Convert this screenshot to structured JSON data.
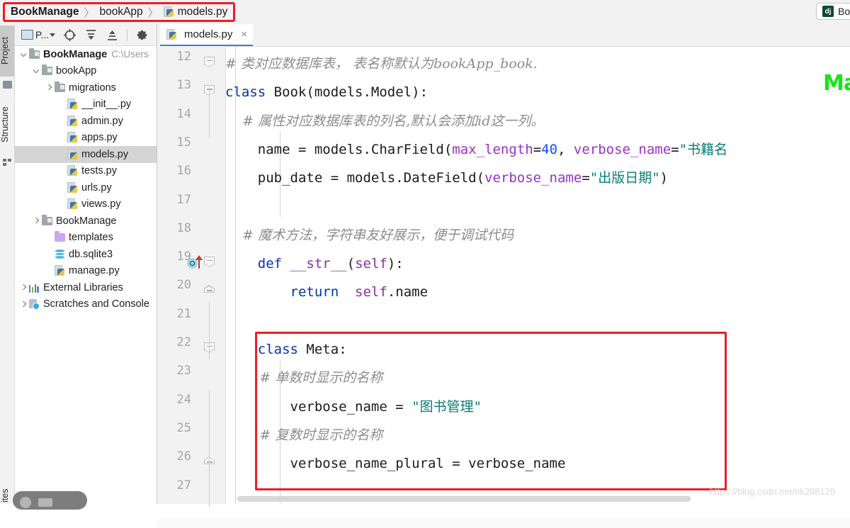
{
  "breadcrumb": {
    "items": [
      {
        "label": "BookManage",
        "bold": true,
        "icon": "none"
      },
      {
        "label": "bookApp",
        "bold": false,
        "icon": "none"
      },
      {
        "label": "models.py",
        "bold": false,
        "icon": "python-file-icon"
      }
    ],
    "separator": "〉"
  },
  "run_config": {
    "badge": "dj",
    "label": "Bo"
  },
  "tool_windows": {
    "project_tab": "Project",
    "structure_tab": "Structure",
    "favorites_tab": "ites"
  },
  "project_panel": {
    "toolbar": {
      "scope_label": "P...",
      "buttons": [
        {
          "name": "project-scope-selector",
          "label": "P..."
        },
        {
          "name": "locate-in-tree-button",
          "label": ""
        },
        {
          "name": "expand-all-button",
          "label": ""
        },
        {
          "name": "collapse-all-button",
          "label": ""
        },
        {
          "name": "settings-gear-button",
          "label": ""
        }
      ]
    },
    "tree": [
      {
        "label": "BookManage",
        "path": "C:\\Users",
        "icon": "folder-module-icon",
        "arrow": "down",
        "indent": 0,
        "bold": true,
        "selected": false
      },
      {
        "label": "bookApp",
        "path": "",
        "icon": "folder-module-icon",
        "arrow": "down",
        "indent": 1,
        "bold": false,
        "selected": false
      },
      {
        "label": "migrations",
        "path": "",
        "icon": "folder-module-icon",
        "arrow": "right",
        "indent": 2,
        "bold": false,
        "selected": false
      },
      {
        "label": "__init__.py",
        "path": "",
        "icon": "python-file-icon",
        "arrow": "none",
        "indent": 3,
        "bold": false,
        "selected": false
      },
      {
        "label": "admin.py",
        "path": "",
        "icon": "python-file-icon",
        "arrow": "none",
        "indent": 3,
        "bold": false,
        "selected": false
      },
      {
        "label": "apps.py",
        "path": "",
        "icon": "python-file-icon",
        "arrow": "none",
        "indent": 3,
        "bold": false,
        "selected": false
      },
      {
        "label": "models.py",
        "path": "",
        "icon": "python-file-icon",
        "arrow": "none",
        "indent": 3,
        "bold": false,
        "selected": true
      },
      {
        "label": "tests.py",
        "path": "",
        "icon": "python-file-icon",
        "arrow": "none",
        "indent": 3,
        "bold": false,
        "selected": false
      },
      {
        "label": "urls.py",
        "path": "",
        "icon": "python-file-icon",
        "arrow": "none",
        "indent": 3,
        "bold": false,
        "selected": false
      },
      {
        "label": "views.py",
        "path": "",
        "icon": "python-file-icon",
        "arrow": "none",
        "indent": 3,
        "bold": false,
        "selected": false
      },
      {
        "label": "BookManage",
        "path": "",
        "icon": "folder-module-icon",
        "arrow": "right",
        "indent": 1,
        "bold": false,
        "selected": false
      },
      {
        "label": "templates",
        "path": "",
        "icon": "folder-purple-icon",
        "arrow": "none",
        "indent": 2,
        "bold": false,
        "selected": false
      },
      {
        "label": "db.sqlite3",
        "path": "",
        "icon": "database-icon",
        "arrow": "none",
        "indent": 2,
        "bold": false,
        "selected": false
      },
      {
        "label": "manage.py",
        "path": "",
        "icon": "python-file-icon",
        "arrow": "none",
        "indent": 2,
        "bold": false,
        "selected": false
      },
      {
        "label": "External Libraries",
        "path": "",
        "icon": "libraries-icon",
        "arrow": "right",
        "indent": 0,
        "bold": false,
        "selected": false
      },
      {
        "label": "Scratches and Console",
        "path": "",
        "icon": "scratches-icon",
        "arrow": "right",
        "indent": 0,
        "bold": false,
        "selected": false
      }
    ]
  },
  "editor": {
    "tab": {
      "label": "models.py",
      "icon": "python-file-icon",
      "close": "×"
    },
    "first_line": 12,
    "lines": [
      {
        "n": 12,
        "fold": "open",
        "gutter_icon": "",
        "tokens": [
          {
            "t": "# 类对应数据库表， 表名称默认为bookApp_book.",
            "c": "cmt"
          }
        ]
      },
      {
        "n": 13,
        "fold": "open",
        "gutter_icon": "",
        "tokens": [
          {
            "t": "class",
            "c": "kw"
          },
          {
            "t": " ",
            "c": "plain"
          },
          {
            "t": "Book",
            "c": "cls"
          },
          {
            "t": "(models.Model):",
            "c": "plain"
          }
        ]
      },
      {
        "n": 14,
        "fold": "",
        "gutter_icon": "",
        "tokens": [
          {
            "t": "    # 属性对应数据库表的列名,默认会添加id这一列。",
            "c": "cmt"
          }
        ]
      },
      {
        "n": 15,
        "fold": "",
        "gutter_icon": "",
        "tokens": [
          {
            "t": "    name = models.CharField(",
            "c": "plain"
          },
          {
            "t": "max_length",
            "c": "kwarg"
          },
          {
            "t": "=",
            "c": "plain"
          },
          {
            "t": "40",
            "c": "num"
          },
          {
            "t": ", ",
            "c": "plain"
          },
          {
            "t": "verbose_name",
            "c": "kwarg"
          },
          {
            "t": "=",
            "c": "plain"
          },
          {
            "t": "\"书籍名",
            "c": "str"
          }
        ]
      },
      {
        "n": 16,
        "fold": "",
        "gutter_icon": "",
        "tokens": [
          {
            "t": "    pub_date = models.DateField(",
            "c": "plain"
          },
          {
            "t": "verbose_name",
            "c": "kwarg"
          },
          {
            "t": "=",
            "c": "plain"
          },
          {
            "t": "\"出版日期\"",
            "c": "str"
          },
          {
            "t": ")",
            "c": "plain"
          }
        ]
      },
      {
        "n": 17,
        "fold": "",
        "gutter_icon": "",
        "tokens": []
      },
      {
        "n": 18,
        "fold": "",
        "gutter_icon": "",
        "tokens": [
          {
            "t": "    # 魔术方法，字符串友好展示，便于调试代码",
            "c": "cmt"
          }
        ]
      },
      {
        "n": 19,
        "fold": "open",
        "gutter_icon": "override-method-icon",
        "tokens": [
          {
            "t": "    ",
            "c": "plain"
          },
          {
            "t": "def",
            "c": "kw"
          },
          {
            "t": " ",
            "c": "plain"
          },
          {
            "t": "__str__",
            "c": "fn"
          },
          {
            "t": "(",
            "c": "plain"
          },
          {
            "t": "self",
            "c": "self"
          },
          {
            "t": "):",
            "c": "plain"
          }
        ]
      },
      {
        "n": 20,
        "fold": "end",
        "gutter_icon": "",
        "tokens": [
          {
            "t": "        ",
            "c": "plain"
          },
          {
            "t": "return",
            "c": "kw"
          },
          {
            "t": "  ",
            "c": "plain"
          },
          {
            "t": "self",
            "c": "self"
          },
          {
            "t": ".name",
            "c": "plain"
          }
        ]
      },
      {
        "n": 21,
        "fold": "",
        "gutter_icon": "",
        "tokens": []
      },
      {
        "n": 22,
        "fold": "open",
        "gutter_icon": "",
        "tokens": [
          {
            "t": "    ",
            "c": "plain"
          },
          {
            "t": "class",
            "c": "kw"
          },
          {
            "t": " ",
            "c": "plain"
          },
          {
            "t": "Meta",
            "c": "cls"
          },
          {
            "t": ":",
            "c": "plain"
          }
        ]
      },
      {
        "n": 23,
        "fold": "",
        "gutter_icon": "",
        "tokens": [
          {
            "t": "        # 单数时显示的名称",
            "c": "cmt"
          }
        ]
      },
      {
        "n": 24,
        "fold": "",
        "gutter_icon": "",
        "tokens": [
          {
            "t": "        verbose_name = ",
            "c": "plain"
          },
          {
            "t": "\"图书管理\"",
            "c": "str"
          }
        ]
      },
      {
        "n": 25,
        "fold": "",
        "gutter_icon": "",
        "tokens": [
          {
            "t": "        # 复数时显示的名称",
            "c": "cmt"
          }
        ]
      },
      {
        "n": 26,
        "fold": "end",
        "gutter_icon": "",
        "tokens": [
          {
            "t": "        verbose_name_plural = verbose_name",
            "c": "plain"
          }
        ]
      },
      {
        "n": 27,
        "fold": "",
        "gutter_icon": "",
        "tokens": []
      }
    ]
  },
  "annotations": {
    "highlight_box_color": "#ee1c25",
    "green_text": "Ma",
    "csdn_watermark": "https://blog.csdn.net/nk298120"
  },
  "colors": {
    "keyword": "#0033b3",
    "string": "#067d74",
    "number": "#1750eb",
    "kwarg": "#9b30c7",
    "comment": "#8c8c8c",
    "function": "#8a2fa8",
    "accent": "#3b7ddd",
    "selection": "#d4d4d4"
  }
}
